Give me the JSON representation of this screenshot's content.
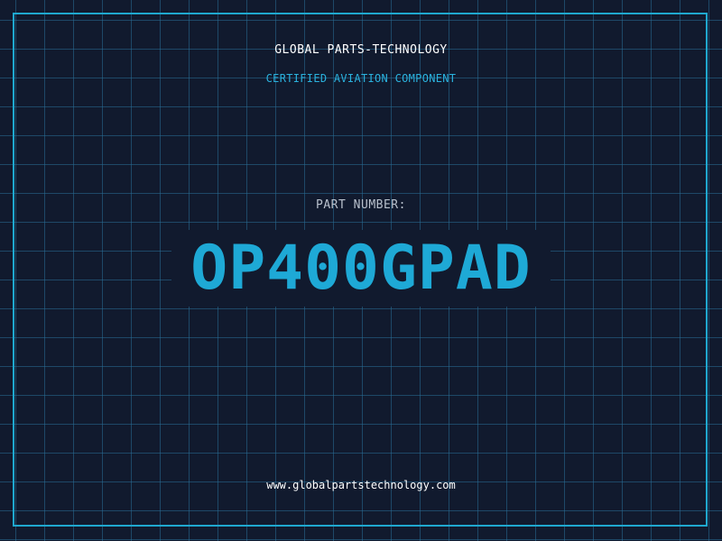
{
  "header": {
    "brand": "GLOBAL PARTS-TECHNOLOGY",
    "subtitle": "CERTIFIED AVIATION COMPONENT"
  },
  "part": {
    "label": "PART NUMBER:",
    "number": "OP400GPAD"
  },
  "footer": {
    "website": "www.globalpartstechnology.com"
  },
  "colors": {
    "background": "#111a2e",
    "grid": "#286e96",
    "accent": "#1ea9d6",
    "text": "#ffffff",
    "label": "#b8c0cc"
  }
}
